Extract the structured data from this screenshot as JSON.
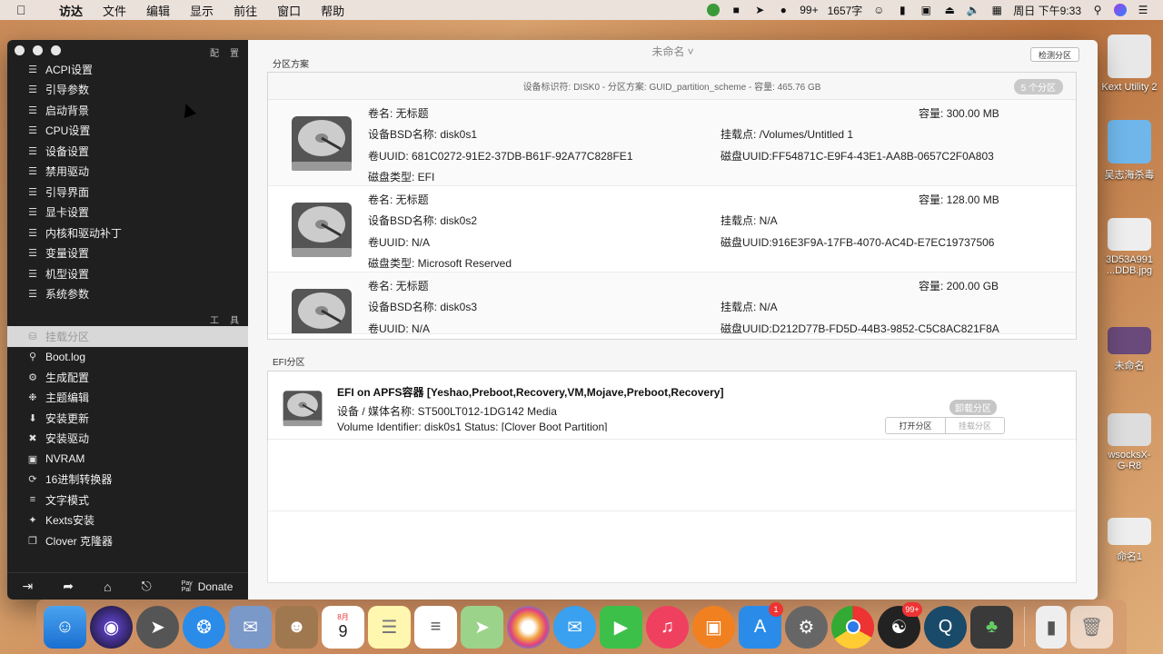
{
  "menubar": {
    "app_name": "访达",
    "items": [
      "文件",
      "编辑",
      "显示",
      "前往",
      "窗口",
      "帮助"
    ],
    "status": {
      "badge99": "99+",
      "word_count": "1657字",
      "datetime": "周日 下午9:33"
    }
  },
  "desktop": {
    "icons": [
      "Kext Utility 2",
      "吴志海杀毒",
      "3D53A991\n...DDB.jpg",
      "未命名",
      "wsocksX-\nG-R8",
      "命名1"
    ]
  },
  "window": {
    "title": "未命名",
    "detect_button": "检测分区",
    "sidebar": {
      "top_icons": [
        "配",
        "置"
      ],
      "config_items": [
        {
          "label": "ACPI设置",
          "icon": "list-icon"
        },
        {
          "label": "引导参数",
          "icon": "list-icon"
        },
        {
          "label": "启动背景",
          "icon": "list-icon"
        },
        {
          "label": "CPU设置",
          "icon": "list-icon"
        },
        {
          "label": "设备设置",
          "icon": "list-icon"
        },
        {
          "label": "禁用驱动",
          "icon": "list-icon"
        },
        {
          "label": "引导界面",
          "icon": "list-icon"
        },
        {
          "label": "显卡设置",
          "icon": "list-icon"
        },
        {
          "label": "内核和驱动补丁",
          "icon": "list-icon"
        },
        {
          "label": "变量设置",
          "icon": "list-icon"
        },
        {
          "label": "机型设置",
          "icon": "list-icon"
        },
        {
          "label": "系统参数",
          "icon": "list-icon"
        }
      ],
      "tools_icons": [
        "工",
        "具"
      ],
      "tool_items": [
        {
          "label": "挂载分区",
          "icon": "disk-icon"
        },
        {
          "label": "Boot.log",
          "icon": "log-icon"
        },
        {
          "label": "生成配置",
          "icon": "gear-icon"
        },
        {
          "label": "主题编辑",
          "icon": "theme-icon"
        },
        {
          "label": "安装更新",
          "icon": "download-icon"
        },
        {
          "label": "安装驱动",
          "icon": "wrench-icon"
        },
        {
          "label": "NVRAM",
          "icon": "chip-icon"
        },
        {
          "label": "16进制转换器",
          "icon": "refresh-icon"
        },
        {
          "label": "文字模式",
          "icon": "text-icon"
        },
        {
          "label": "Kexts安装",
          "icon": "kext-icon"
        },
        {
          "label": "Clover 克隆器",
          "icon": "clone-icon"
        }
      ],
      "donate": "Donate",
      "paypal_text": "Pay Pal"
    },
    "partition": {
      "section_label": "分区方案",
      "header": "设备标识符: DISK0 - 分区方案: GUID_partition_scheme - 容量: 465.76 GB",
      "count_badge": "5 个分区",
      "rows": [
        {
          "name": "卷名: 无标题",
          "capacity": "容量:  300.00 MB",
          "bsd": "设备BSD名称: disk0s1",
          "mount": "挂载点: /Volumes/Untitled 1",
          "vol_uuid": "卷UUID: 681C0272-91E2-37DB-B61F-92A77C828FE1",
          "disk_uuid": "磁盘UUID:FF54871C-E9F4-43E1-AA8B-0657C2F0A803",
          "disk_type": "磁盘类型: EFI"
        },
        {
          "name": "卷名: 无标题",
          "capacity": "容量:  128.00 MB",
          "bsd": "设备BSD名称: disk0s2",
          "mount": "挂载点: N/A",
          "vol_uuid": "卷UUID: N/A",
          "disk_uuid": "磁盘UUID:916E3F9A-17FB-4070-AC4D-E7EC19737506",
          "disk_type": "磁盘类型: Microsoft Reserved"
        },
        {
          "name": "卷名: 无标题",
          "capacity": "容量:  200.00 GB",
          "bsd": "设备BSD名称: disk0s3",
          "mount": "挂载点: N/A",
          "vol_uuid": "卷UUID: N/A",
          "disk_uuid": "磁盘UUID:D212D77B-FD5D-44B3-9852-C5C8AC821F8A",
          "disk_type": ""
        }
      ]
    },
    "efi": {
      "section_label": "EFI分区",
      "title": "EFI on APFS容器 [Yeshao,Preboot,Recovery,VM,Mojave,Preboot,Recovery]",
      "media": "设备 / 媒体名称: ST500LT012-1DG142 Media",
      "volume_line": "Volume Identifier: disk0s1 Status: [Clover Boot Partition]",
      "unmount_badge": "卸载分区",
      "open_button": "打开分区",
      "mount_button": "挂载分区"
    }
  },
  "dock": {
    "calendar_month": "8月",
    "calendar_day": "9",
    "appstore_badge": "1",
    "qq_badge": "99+"
  }
}
